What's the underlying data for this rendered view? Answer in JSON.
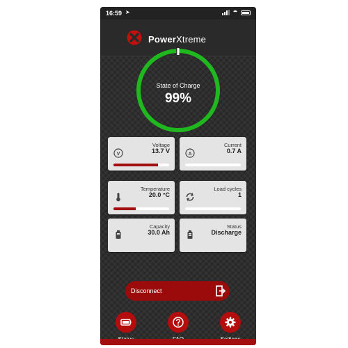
{
  "status_bar": {
    "time": "16:59",
    "location_icon": "location-arrow-icon"
  },
  "header": {
    "brand_bold": "Power",
    "brand_thin": "Xtreme"
  },
  "gauge": {
    "title": "State of Charge",
    "value": "99%",
    "fraction": 0.99,
    "color": "#1fb81f"
  },
  "cards": {
    "voltage": {
      "label": "Voltage",
      "value": "13.7 V",
      "fill": 0.8,
      "icon": "voltage-icon"
    },
    "current": {
      "label": "Current",
      "value": "0.7 A",
      "fill": 0.0,
      "icon": "current-icon"
    },
    "temperature": {
      "label": "Temperature",
      "value": "20.0 °C",
      "fill": 0.4,
      "icon": "thermometer-icon"
    },
    "load_cycles": {
      "label": "Load cycles",
      "value": "1",
      "fill": 0.0,
      "icon": "cycle-icon"
    },
    "capacity": {
      "label": "Capacity",
      "value": "30.0 Ah",
      "icon": "battery-icon"
    },
    "status": {
      "label": "Status",
      "value": "Discharge",
      "icon": "battery-status-icon"
    }
  },
  "disconnect": {
    "label": "Disconnect"
  },
  "nav": {
    "status": "Status",
    "faq": "FAQ",
    "settings": "Settings"
  },
  "colors": {
    "accent": "#a30e0e",
    "card": "#e4e4e4",
    "background": "#2e2e2e"
  }
}
